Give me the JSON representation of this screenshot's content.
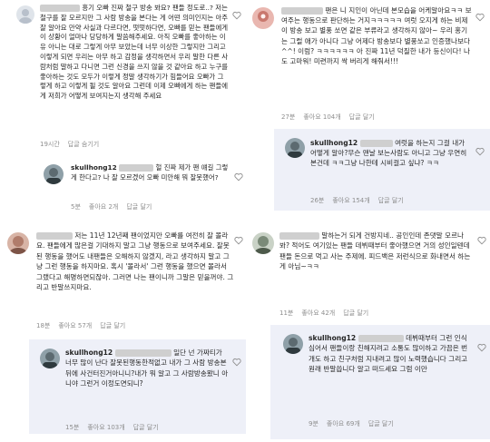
{
  "colors": {
    "text": "#262626",
    "meta": "#8e8e8e",
    "verified": "#3897f0",
    "highlight": "#eef0f8"
  },
  "top_left": {
    "comment": {
      "text": "흥기 오빠 진짜 철구 방송 봐요? 팬들 정도로..? 저는 철구를 잘 모르지만 그 사람 방송을 본다는 게 어떤 의미인지는 아주 잘 알아요 만약 사실과 다르다면, 떳떳하다면, 오빠를 믿는 팬들에게 이 상황이 얼마나 당당하게 말씀해주세요. 아직 오빠를 좋아하는 이유 아니는 대로 그렇게 아무 보았는데 너무 이상한 그렇지만 그리고 이렇게 되면 우리는 아무 하고 감정을 생각하면서 우리 말한 다른 사람처럼 말하고 다니면 그런 신경을 쓰지 않을 것 같아요 하고 누구를 좋아하는 것도 모두가 이렇게 정말 생각하기가 힘들어요 오빠가 그렇게 하고 이렇게 될 것도 알아요 그런데 이제 오빠에게 하는 팬들에게 저희가 어떻게 보여지는지 생각해 주세요",
      "meta": [
        "19시간",
        "답글 숨기기"
      ]
    },
    "reply": {
      "username": "skullhong12",
      "text": "헐 진짜 제가 팬 얘길 그렇게 한다고? 나 잘 모르겠어 오빠 미안해 뭐 잘못했어?",
      "meta": [
        "5분",
        "좋아요 2개",
        "답글 달기"
      ]
    }
  },
  "top_right": {
    "comment": {
      "text": "팬은 니 지인이 아닌데 본모습을 어케알아요ㅋㅋ 보여주는 행동으로 판단하는 거지ㅋㅋㅋㅋㅋ 여럿 오지게 하는 비제이 방송 보고 별풍 쏘면 같은 부류라고 생각하지 않아~ 우리 홍기는 그럴 애가 아니다 그냥 어제다 방송보다 별풍쏘고 인증했나보다^^! 이럼? ㅋㅋㅋㅋㅋㅋ 아 진짜 11년 덕질한 내가 등신이다! 나도 고마워! 미련까지 싹 버리게 해줘서!!!",
      "meta": [
        "27분",
        "좋아요 104개",
        "답글 달기"
      ]
    },
    "reply": {
      "username": "skullhong12",
      "text": "여럿을 하는지 그걸 내가 어떻게 알아?무슨 맨날 보는사람도 아니고 그냥 우연히 본건데 ㅋㅋ그냥 나한테 시비걸고 싶냐? ㅋㅋ",
      "meta": [
        "26분",
        "좋아요 154개",
        "답글 달기"
      ]
    }
  },
  "bottom_left": {
    "comment": {
      "text": "저는 11년 12년째 팬이었지만 오빠를 여전히 잘 몰라요. 팬들에게 많은걸 기대하지 말고 그냥 행동으로 보여주세요. 잘못된 행동을 했어도 내팬들은 오해하지 않겠지, 라고 생각하지 말고 그냥 그런 행동을 하지마요. 혹시 '몰라서' 그런 행동을 했으면 몰라서 그랬다고 해명하면되잖아. 그러면 나는 팬이니까 그말은 믿을꺼야. 그리고 반말쓰지마요.",
      "meta": [
        "18분",
        "좋아요 57개",
        "답글 달기"
      ]
    },
    "reply": {
      "username": "skullhong12",
      "text": "일단 넌 가짜티가 너무 많이 난다 잘못된행동한적없고 내가 그 사람 방송본뒤에 사건터진거아니니?내가 뭐 알고 그 사람방송봤니 아니야 그런거 이정도면되니?",
      "meta": [
        "15분",
        "좋아요 103개",
        "답글 달기"
      ]
    }
  },
  "bottom_right": {
    "comment": {
      "text": "말하는거 되게 건방지네.. 공인인데 존댓말 모르나봐? 적어도 여기있는 팬들 데뷔때부터 좋아했으면 거의 성인일텐데 팬들 돈으로 먹고 사는 주제에. 피드백은 저런식으로 화내면서 하는게 아님~ㅋㅋ",
      "meta": [
        "11분",
        "좋아요 42개",
        "답글 달기"
      ]
    },
    "reply": {
      "username": "skullhong12",
      "text": "데뷔때부터 그런 인식 심어서 팬들이랑 친해지려고 소통도 많이하고 가끔은 번개도 하고 친구처럼 지내려고 많이 노력했습니다 그리고 원래 반말씁니다 알고 떠드세요 그럼 이만",
      "meta": [
        "9분",
        "좋아요 69개",
        "답글 달기"
      ]
    }
  }
}
